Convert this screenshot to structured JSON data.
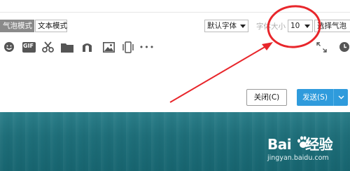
{
  "toolbar": {
    "mode_tabs": [
      {
        "label": "气泡模式",
        "active": true
      },
      {
        "label": "文本模式",
        "active": false
      }
    ],
    "font_select": {
      "value": "默认字体"
    },
    "font_size_label": "字体大小",
    "font_size_select": {
      "value": "10"
    },
    "bubble_select": {
      "label": "选择气泡"
    },
    "icons": [
      "emoji-icon",
      "gif-icon",
      "scissors-icon",
      "folder-icon",
      "music-icon",
      "image-icon",
      "vibrate-icon",
      "more-icon",
      "expand-icon",
      "history-icon"
    ],
    "gif_text": "GIF",
    "more_text": "•••"
  },
  "actions": {
    "close_label": "关闭(C)",
    "send_label": "发送(S)"
  },
  "watermark": {
    "logo_left": "Bai",
    "logo_right": "经验",
    "url": "jingyan.baidu.com"
  },
  "colors": {
    "send_button": "#2f9bdc",
    "annotation": "#e8262b",
    "desktop": "#1f6f7a"
  }
}
